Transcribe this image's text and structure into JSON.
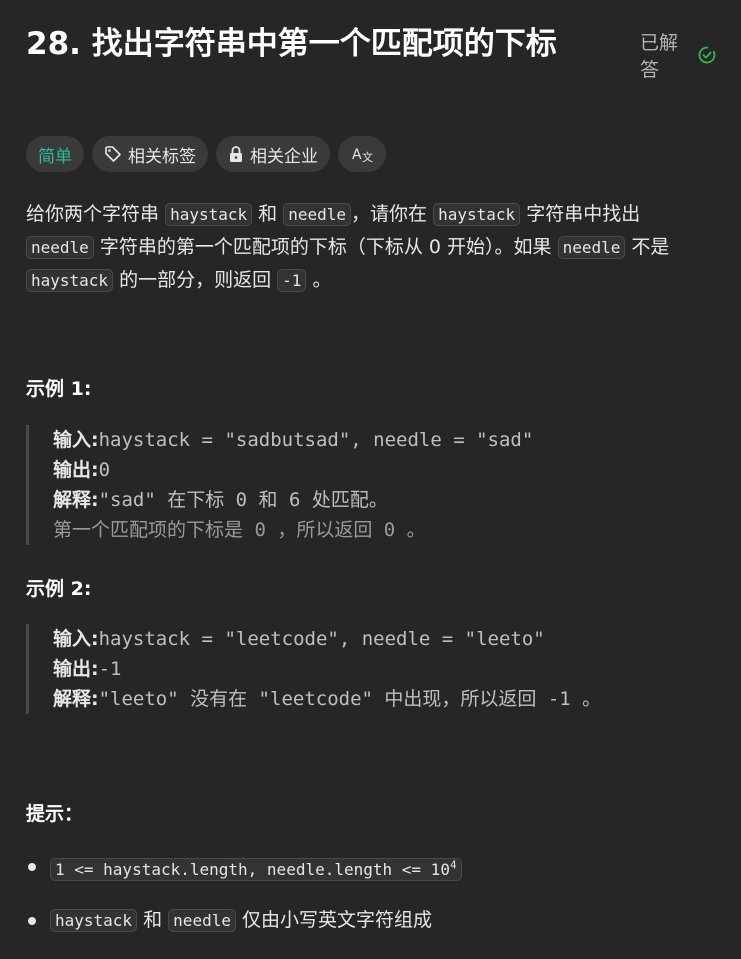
{
  "problem": {
    "title": "28. 找出字符串中第一个匹配项的下标",
    "status": "已解答"
  },
  "tags": {
    "difficulty": "简单",
    "topics": "相关标签",
    "companies": "相关企业",
    "lang_icon": "translate-icon"
  },
  "description": {
    "p1": "给你两个字符串",
    "c1": "haystack",
    "p2": "和",
    "c2": "needle",
    "p3": "，请你在",
    "c3": "haystack",
    "p4": "字符串中找出",
    "c4": "needle",
    "p5": "字符串的第一个匹配项的下标（下标从 0 开始）。如果",
    "c5": "needle",
    "p6": "不是",
    "c6": "haystack",
    "p7": "的一部分，则返回",
    "c7": "-1",
    "p8": "。"
  },
  "examples": [
    {
      "heading": "示例 1:",
      "input_label": "输入:",
      "input": "haystack = \"sadbutsad\", needle = \"sad\"",
      "output_label": "输出:",
      "output": "0",
      "explain_label": "解释:",
      "explain": "\"sad\" 在下标 0 和 6 处匹配。",
      "extra": "第一个匹配项的下标是 0 ，所以返回 0 。"
    },
    {
      "heading": "示例 2:",
      "input_label": "输入:",
      "input": "haystack = \"leetcode\", needle = \"leeto\"",
      "output_label": "输出:",
      "output": "-1",
      "explain_label": "解释:",
      "explain": "\"leeto\" 没有在 \"leetcode\" 中出现，所以返回 -1 。"
    }
  ],
  "constraints": {
    "heading": "提示：",
    "c1_code": "1 <= haystack.length, needle.length <= 10",
    "c1_sup": "4",
    "c2_a": "haystack",
    "c2_and": "和",
    "c2_b": "needle",
    "c2_rest": "仅由小写英文字符组成"
  },
  "colors": {
    "background": "#262626",
    "easy": "#2cbb9f",
    "solved_check": "#2cbb4f"
  }
}
